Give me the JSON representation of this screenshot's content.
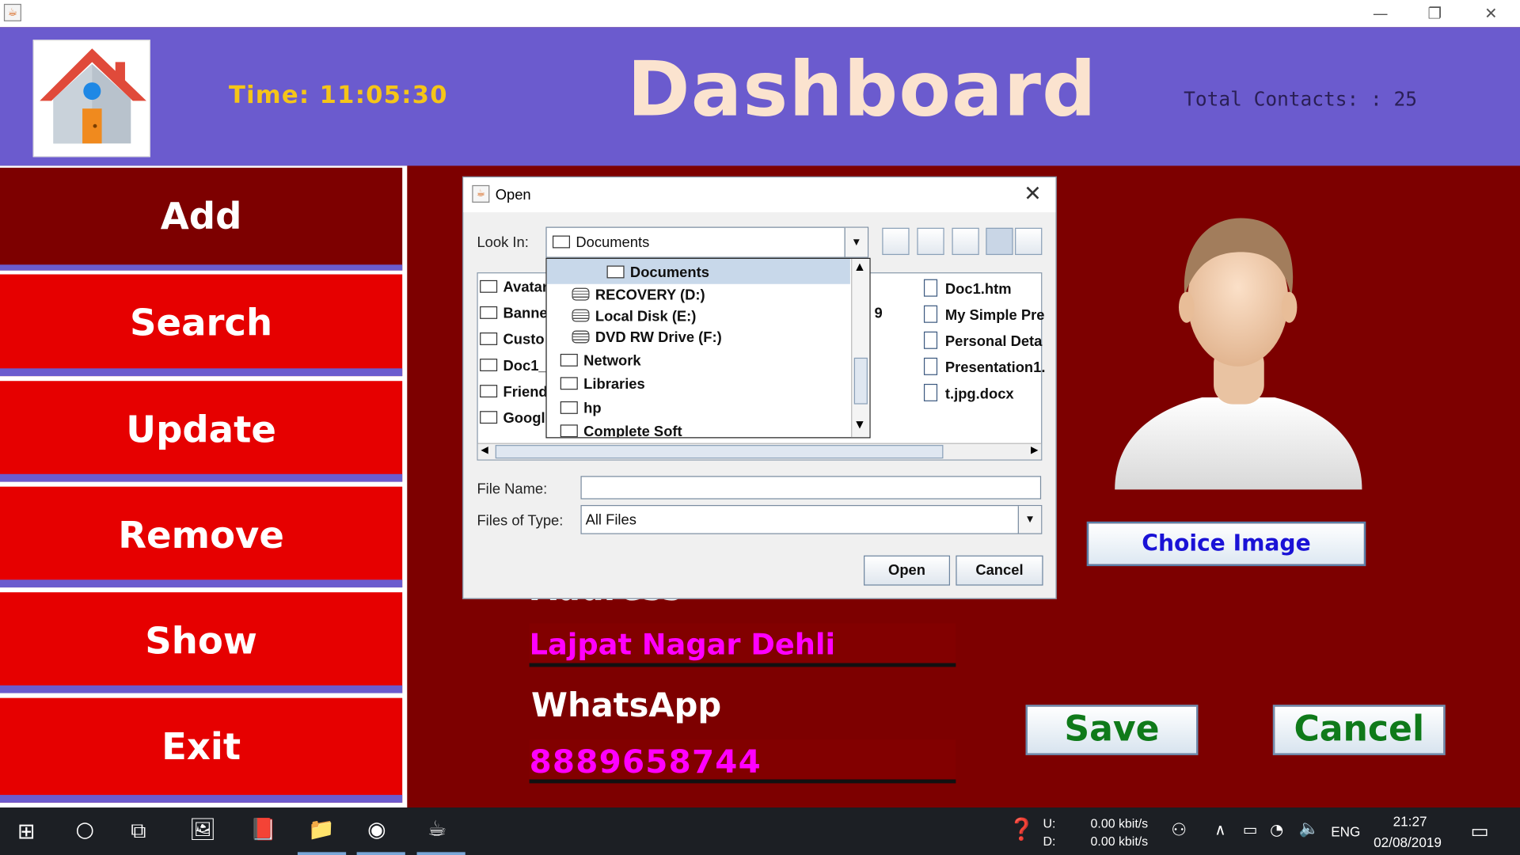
{
  "window": {
    "minimize": "—",
    "restore": "❐",
    "close": "✕"
  },
  "header": {
    "time_label": "Time:",
    "time_value": "11:05:30",
    "title": "Dashboard",
    "total_contacts": "Total Contacts: : 25"
  },
  "sidebar": {
    "items": [
      {
        "label": "Add"
      },
      {
        "label": "Search"
      },
      {
        "label": "Update"
      },
      {
        "label": "Remove"
      },
      {
        "label": "Show"
      },
      {
        "label": "Exit"
      }
    ]
  },
  "form": {
    "address_label": "Address",
    "address_value": "Lajpat Nagar Dehli",
    "whatsapp_label": "WhatsApp",
    "whatsapp_value": "8889658744",
    "choice_image_label": "Choice Image",
    "save_label": "Save",
    "cancel_label": "Cancel"
  },
  "dialog": {
    "title": "Open",
    "look_in_label": "Look In:",
    "look_in_value": "Documents",
    "popup_items": [
      {
        "label": "Documents",
        "icon": "folder-icon"
      },
      {
        "label": "RECOVERY (D:)",
        "icon": "disk-icon"
      },
      {
        "label": "Local Disk (E:)",
        "icon": "disk-icon"
      },
      {
        "label": "DVD RW Drive (F:)",
        "icon": "disk-icon"
      },
      {
        "label": "Network",
        "icon": "folder-icon"
      },
      {
        "label": "Libraries",
        "icon": "folder-icon"
      },
      {
        "label": "hp",
        "icon": "folder-icon"
      },
      {
        "label": "Complete Soft",
        "icon": "folder-icon"
      }
    ],
    "left_files": [
      "Avatar",
      "Banne",
      "Custo",
      "Doc1_",
      "Friend",
      "Googl"
    ],
    "middle_fragment": "9",
    "right_files": [
      "Doc1.htm",
      "My Simple Pre",
      "Personal Deta",
      "Presentation1.",
      "t.jpg.docx"
    ],
    "file_name_label": "File Name:",
    "file_name_value": "",
    "files_of_type_label": "Files of Type:",
    "files_of_type_value": "All Files",
    "open_button": "Open",
    "cancel_button": "Cancel"
  },
  "taskbar": {
    "net_up_label": "U:",
    "net_down_label": "D:",
    "net_up_value": "0.00 kbit/s",
    "net_down_value": "0.00 kbit/s",
    "language": "ENG",
    "clock_time": "21:27",
    "clock_date": "02/08/2019"
  }
}
